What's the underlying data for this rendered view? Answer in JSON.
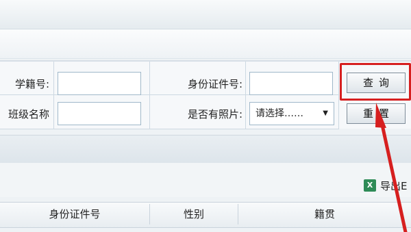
{
  "search_form": {
    "student_id_label": "学籍号:",
    "student_id_value": "",
    "id_card_label": "身份证件号:",
    "id_card_value": "",
    "class_name_label": "班级名称",
    "class_name_value": "",
    "has_photo_label": "是否有照片:",
    "has_photo_selected": "请选择……"
  },
  "buttons": {
    "query_label": "查询",
    "reset_label": "重置"
  },
  "toolbar": {
    "export_label": "导出E"
  },
  "table": {
    "columns": [
      "身份证件号",
      "性别",
      "籍贯"
    ]
  },
  "annotation": {
    "highlight_color": "#d61f1f",
    "arrow_color": "#d61f1f"
  }
}
